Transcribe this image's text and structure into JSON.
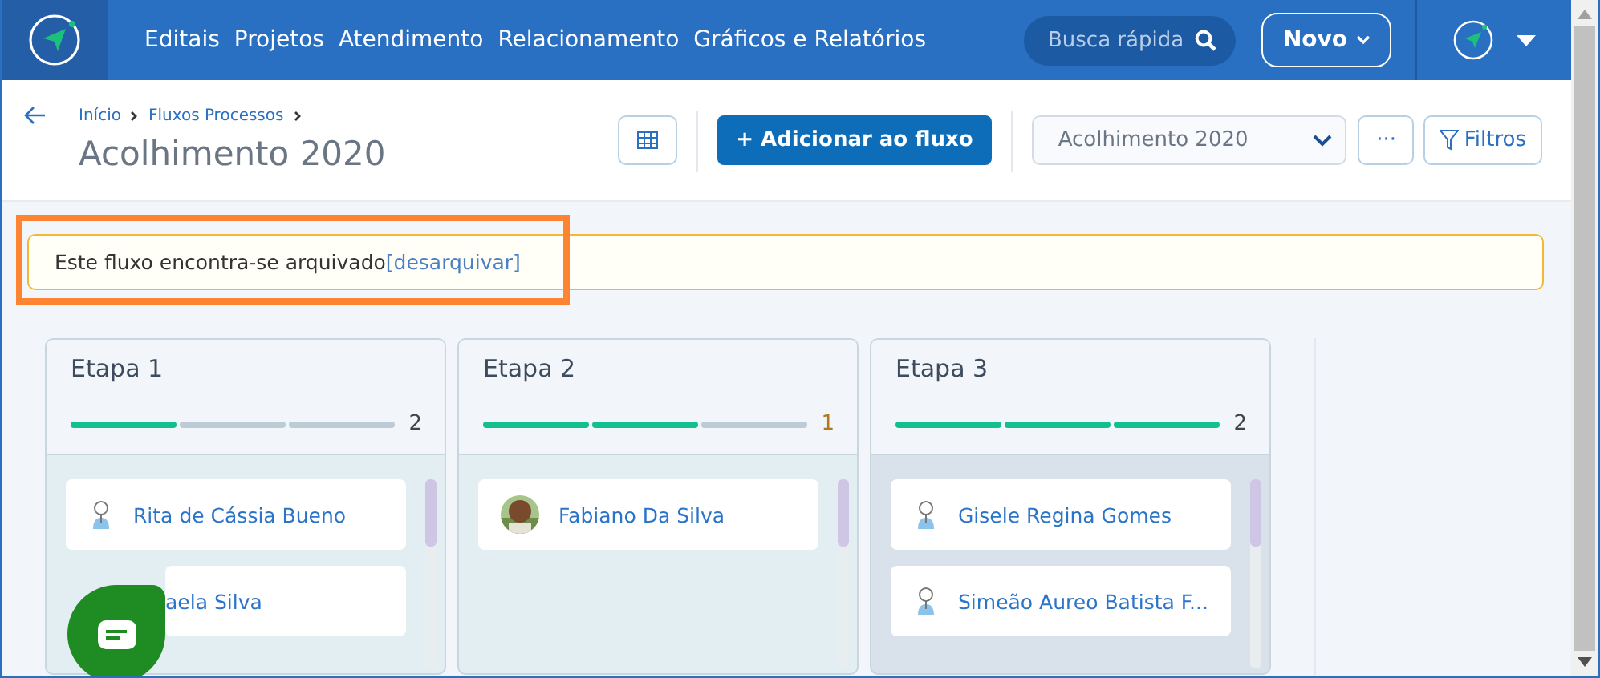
{
  "nav": {
    "items": [
      "Editais",
      "Projetos",
      "Atendimento",
      "Relacionamento",
      "Gráficos e Relatórios"
    ],
    "search": {
      "placeholder": "Busca rápida"
    },
    "new_button": "Novo"
  },
  "header": {
    "breadcrumbs": [
      "Início",
      "Fluxos Processos"
    ],
    "title": "Acolhimento 2020",
    "add_button": "+ Adicionar ao fluxo",
    "flow_select": "Acolhimento 2020",
    "more_button": "···",
    "filter_button": "Filtros"
  },
  "alert": {
    "text": "Este fluxo encontra-se arquivado",
    "link": "[desarquivar]"
  },
  "columns": [
    {
      "title": "Etapa 1",
      "progress": [
        true,
        false,
        false
      ],
      "count": "2",
      "selected": false,
      "cards": [
        {
          "name": "Rita de Cássia Bueno",
          "kind": "placeholder"
        },
        {
          "name": "aela Silva",
          "kind": "covered"
        }
      ]
    },
    {
      "title": "Etapa 2",
      "progress": [
        true,
        true,
        false
      ],
      "count": "1",
      "selected": false,
      "cards": [
        {
          "name": "Fabiano Da Silva"
        }
      ]
    },
    {
      "title": "Etapa 3",
      "progress": [
        true,
        true,
        true
      ],
      "count": "2",
      "selected": true,
      "cards": [
        {
          "name": "Gisele Regina Gomes",
          "kind": "placeholder"
        },
        {
          "name": "Simeão Aureo Batista F...",
          "kind": "placeholder"
        }
      ]
    }
  ]
}
